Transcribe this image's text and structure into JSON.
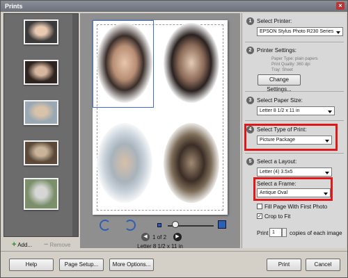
{
  "window": {
    "title": "Prints",
    "close_glyph": "×"
  },
  "strip": {
    "thumbnails": [
      {
        "name": "photo-1",
        "colors": [
          "#3b3b3b",
          "#e9c9b0"
        ]
      },
      {
        "name": "photo-2",
        "colors": [
          "#2e2420",
          "#d7b7a0"
        ]
      },
      {
        "name": "photo-3",
        "colors": [
          "#9aa8b4",
          "#d9c3a8"
        ]
      },
      {
        "name": "photo-4",
        "colors": [
          "#5b4a3a",
          "#c9b49a"
        ]
      },
      {
        "name": "photo-5",
        "colors": [
          "#7a8f6a",
          "#d6d6d6"
        ]
      }
    ],
    "add_label": "Add...",
    "remove_label": "Remove"
  },
  "preview": {
    "page_indicator": "1 of 2",
    "paper_label": "Letter 8 1/2 x 11 in"
  },
  "panel": {
    "printer": {
      "step": "1",
      "label": "Select Printer:",
      "value": "EPSON Stylus Photo R230 Series"
    },
    "settings": {
      "step": "2",
      "label": "Printer Settings:",
      "paper_type": "Paper Type: plain papers",
      "print_quality": "Print Quality: 360 dpi",
      "tray": "Tray: Sheet",
      "button": "Change Settings..."
    },
    "paper_size": {
      "step": "3",
      "label": "Select Paper Size:",
      "value": "Letter 8 1/2 x 11 in"
    },
    "print_type": {
      "step": "4",
      "label": "Select Type of Print:",
      "value": "Picture Package"
    },
    "layout": {
      "step": "5",
      "label": "Select a Layout:",
      "value": "Letter (4) 3.5x5"
    },
    "frame": {
      "label": "Select a Frame:",
      "value": "Antique Oval"
    },
    "fill_page": {
      "label": "Fill Page With First Photo",
      "checked": false
    },
    "crop_to_fit": {
      "label": "Crop to Fit",
      "checked": true,
      "check_glyph": "✓"
    },
    "copies": {
      "prefix": "Print",
      "value": "1",
      "suffix": "copies of each image"
    }
  },
  "footer": {
    "help": "Help",
    "page_setup": "Page Setup...",
    "more_options": "More Options...",
    "print": "Print",
    "cancel": "Cancel"
  },
  "colors": {
    "highlight": "#e01818",
    "accent": "#2b5fb3",
    "add_green": "#2a8a2a"
  }
}
